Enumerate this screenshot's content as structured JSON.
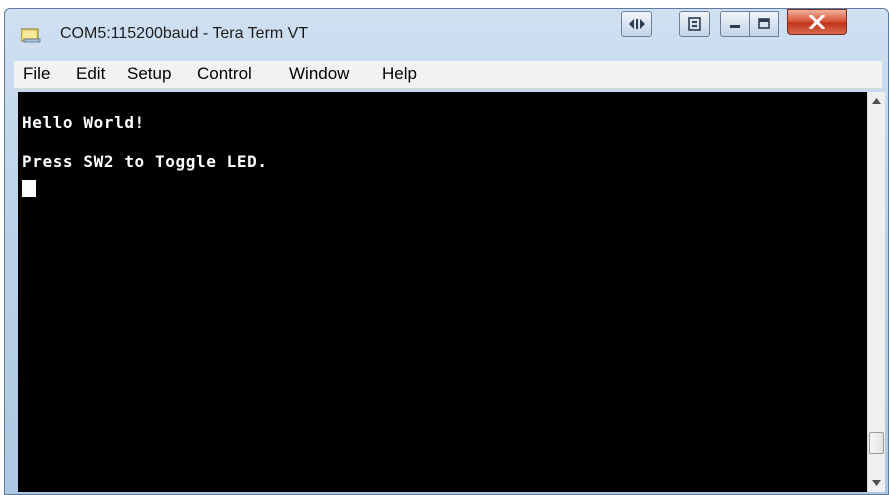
{
  "window": {
    "title": "COM5:115200baud - Tera Term VT"
  },
  "titlebar": {
    "icons": {
      "app": "tera-term-icon",
      "extra1": "swap-icon",
      "extra2": "restore-layout-icon",
      "minimize": "minimize-icon",
      "maximize": "maximize-icon",
      "close": "close-icon"
    }
  },
  "menubar": {
    "items": [
      "File",
      "Edit",
      "Setup",
      "Control",
      "Window",
      "Help"
    ]
  },
  "terminal": {
    "background": "#000000",
    "foreground": "#ffffff",
    "lines": [
      "Hello World!",
      "Press SW2 to Toggle LED."
    ]
  },
  "colors": {
    "close_button": "#c8402a",
    "titlebar": "#bcd3ea",
    "menubar": "#f2f2f2"
  }
}
